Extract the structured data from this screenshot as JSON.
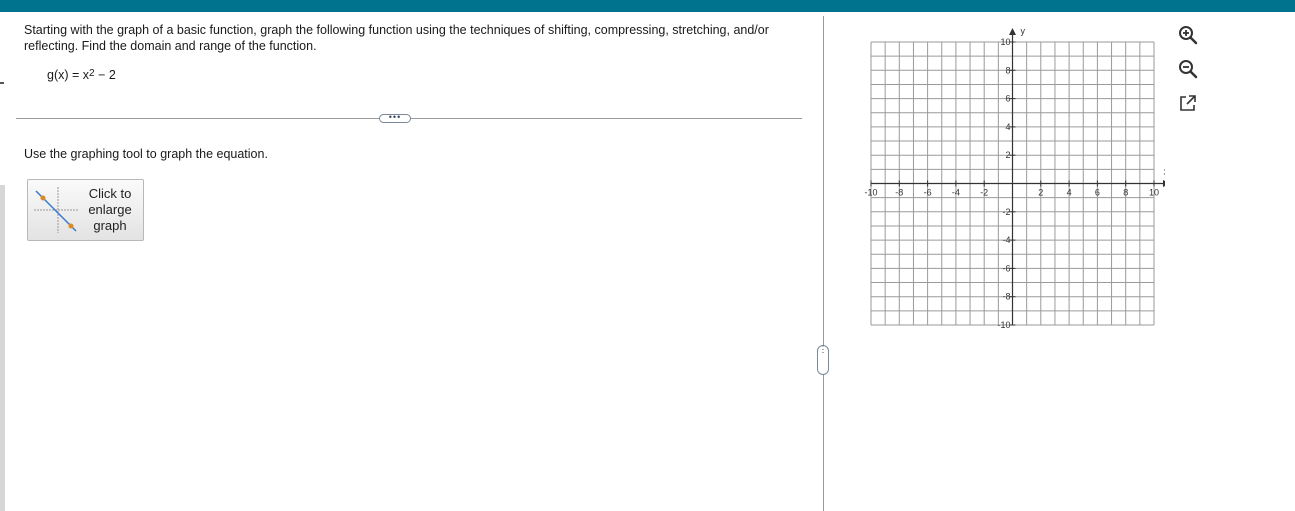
{
  "colors": {
    "header_bar": "#00738f",
    "grid_line": "#9a9a9a",
    "axis": "#333333",
    "thumb_line": "#3a7ad0",
    "thumb_point": "#e08a1e"
  },
  "question": {
    "prompt": "Starting with the graph of a basic function, graph the following function using the techniques of shifting, compressing, stretching, and/or reflecting. Find the domain and range of the function.",
    "function_lhs": "g(x) = x",
    "function_exponent": "2",
    "function_rhs": " − 2",
    "more_label": "•••",
    "instruction": "Use the graphing tool to graph the equation.",
    "enlarge_button": {
      "line1": "Click to",
      "line2": "enlarge",
      "line3": "graph"
    }
  },
  "graph": {
    "x_axis_label": "x",
    "y_axis_label": "y",
    "x_tick_labels": [
      "-10",
      "-8",
      "-6",
      "-4",
      "-2",
      "2",
      "4",
      "6",
      "8",
      "10"
    ],
    "y_tick_labels": [
      "10",
      "8",
      "6",
      "4",
      "2",
      "-2",
      "-4",
      "-6",
      "-8",
      "-10"
    ],
    "x_range": [
      -10,
      10
    ],
    "y_range": [
      -10,
      10
    ],
    "grid_step": 1,
    "label_step": 2
  },
  "tools": {
    "zoom_in_icon": "magnifier-plus",
    "zoom_out_icon": "magnifier-minus",
    "popout_icon": "open-in-new-window"
  },
  "splitter_handle_label": "⋮"
}
